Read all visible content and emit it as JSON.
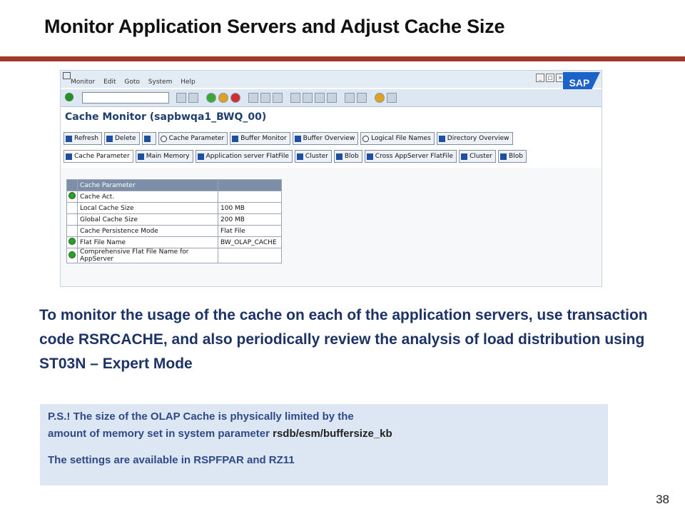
{
  "slide": {
    "title": "Monitor Application Servers and Adjust Cache Size",
    "page_number": "38",
    "description": "To monitor the usage of the cache on each of the application servers, use transaction code RSRCACHE, and also periodically review the analysis of load distribution using ST03N – Expert Mode",
    "note_line1": "P.S.! The size of the OLAP Cache is physically limited by the",
    "note_line2_prefix": "amount of memory set in system parameter ",
    "note_line2_param": "rsdb/esm/buffersize_kb",
    "note_line3": "The settings are available in RSPFPAR and RZ11"
  },
  "sap": {
    "logo": "SAP",
    "menu": [
      "Monitor",
      "Edit",
      "Goto",
      "System",
      "Help"
    ],
    "screen_title": "Cache Monitor (sapbwqa1_BWQ_00)",
    "buttons_row1": [
      "Refresh",
      "Delete",
      "Cache Parameter",
      "Buffer Monitor",
      "Buffer Overview",
      "Logical File Names",
      "Directory Overview"
    ],
    "buttons_row2": [
      "Cache Parameter",
      "Main Memory",
      "Application server FlatFile",
      "Cluster",
      "Blob",
      "Cross AppServer FlatFile",
      "Cluster",
      "Blob"
    ],
    "table": {
      "header": "Cache Parameter",
      "rows": [
        {
          "label": "Cache Act.",
          "value": "",
          "icon": "green-light-icon"
        },
        {
          "label": "Local Cache Size",
          "value": "100 MB",
          "icon": ""
        },
        {
          "label": "Global Cache Size",
          "value": "200 MB",
          "icon": ""
        },
        {
          "label": "Cache Persistence Mode",
          "value": "Flat File",
          "icon": ""
        },
        {
          "label": "Flat File Name",
          "value": "BW_OLAP_CACHE",
          "icon": "green-light-icon"
        },
        {
          "label": "Comprehensive Flat File Name for AppServer",
          "value": "",
          "icon": "green-light-icon"
        }
      ]
    }
  },
  "colors": {
    "title_rule": "#a0382c",
    "body_text": "#1d3265",
    "note_bg": "#dde6f3",
    "sap_blue": "#1b63c9"
  }
}
